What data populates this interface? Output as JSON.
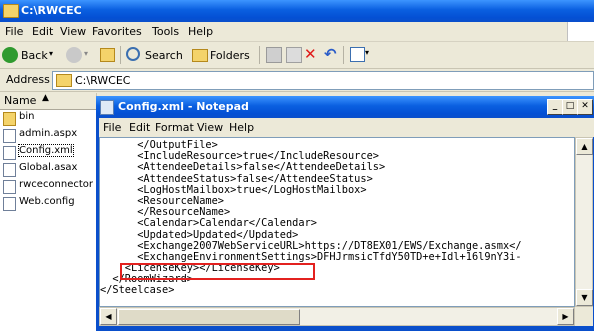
{
  "explorer": {
    "title": "C:\\RWCEC",
    "menu": [
      "File",
      "Edit",
      "View",
      "Favorites",
      "Tools",
      "Help"
    ],
    "toolbar": {
      "back_label": "Back",
      "search_label": "Search",
      "folders_label": "Folders"
    },
    "address_label": "Address",
    "address_value": "C:\\RWCEC",
    "column_header": "Name",
    "files": [
      {
        "name": "bin",
        "icon": "folder-icon"
      },
      {
        "name": "admin.aspx",
        "icon": "file-icon"
      },
      {
        "name": "Config.xml",
        "icon": "file-icon"
      },
      {
        "name": "Global.asax",
        "icon": "file-icon"
      },
      {
        "name": "rwceconnector",
        "icon": "file-icon"
      },
      {
        "name": "Web.config",
        "icon": "file-icon"
      }
    ]
  },
  "notepad": {
    "title": "Config.xml - Notepad",
    "menu": [
      "File",
      "Edit",
      "Format",
      "View",
      "Help"
    ],
    "lines": [
      "      </OutputFile>",
      "      <IncludeResource>true</IncludeResource>",
      "      <AttendeeDetails>false</AttendeeDetails>",
      "      <AttendeeStatus>false</AttendeeStatus>",
      "      <LogHostMailbox>true</LogHostMailbox>",
      "      <ResourceName>",
      "      </ResourceName>",
      "      <Calendar>Calendar</Calendar>",
      "      <Updated>Updated</Updated>",
      "      <Exchange2007WebServiceURL>https://DT8EX01/EWS/Exchange.asmx</",
      "      <ExchangeEnvironmentSettings>DFHJrmsicTfdY50TD+e+Idl+16l9nY3i-",
      "    <LicenseKey></LicenseKey>",
      "  </RoomWizard>",
      "</Steelcase>"
    ]
  }
}
